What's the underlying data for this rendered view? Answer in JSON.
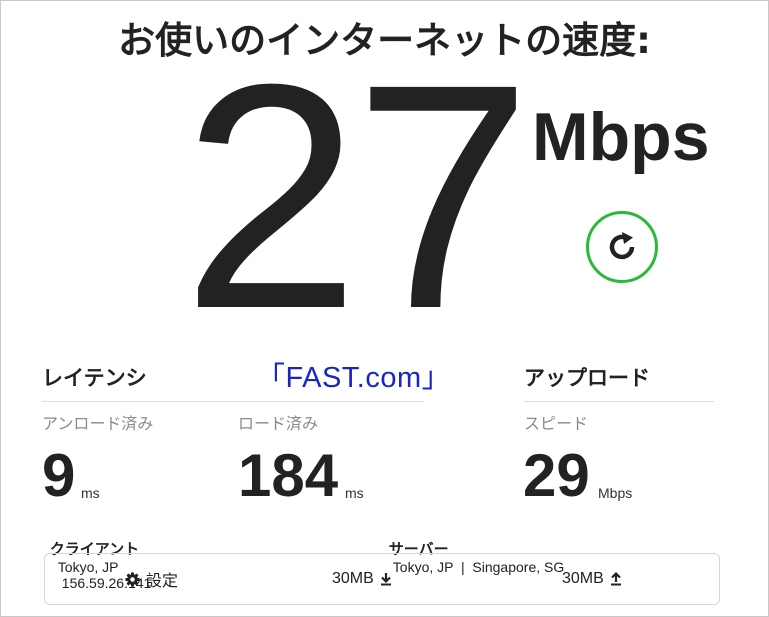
{
  "title": "お使いのインターネットの速度:",
  "download": {
    "value": "27",
    "unit": "Mbps"
  },
  "refresh_icon": "refresh-icon",
  "watermark": "「FAST.com」",
  "latency": {
    "heading": "レイテンシ",
    "unloaded": {
      "label": "アンロード済み",
      "value": "9",
      "unit": "ms"
    },
    "loaded": {
      "label": "ロード済み",
      "value": "184",
      "unit": "ms"
    }
  },
  "upload": {
    "heading": "アップロード",
    "speed_label": "スピード",
    "value": "29",
    "unit": "Mbps"
  },
  "client": {
    "label": "クライアント",
    "location": "Tokyo, JP",
    "ip": "156.59.26.141"
  },
  "server": {
    "label": "サーバー",
    "locations": "Tokyo, JP  |  Singapore, SG"
  },
  "settings_bar": {
    "settings_label": "設定",
    "download_size": "30MB",
    "upload_size": "30MB"
  },
  "colors": {
    "accent": "#2db838",
    "watermark": "#1a26c2",
    "text": "#222222",
    "muted": "#8a8a8a"
  }
}
